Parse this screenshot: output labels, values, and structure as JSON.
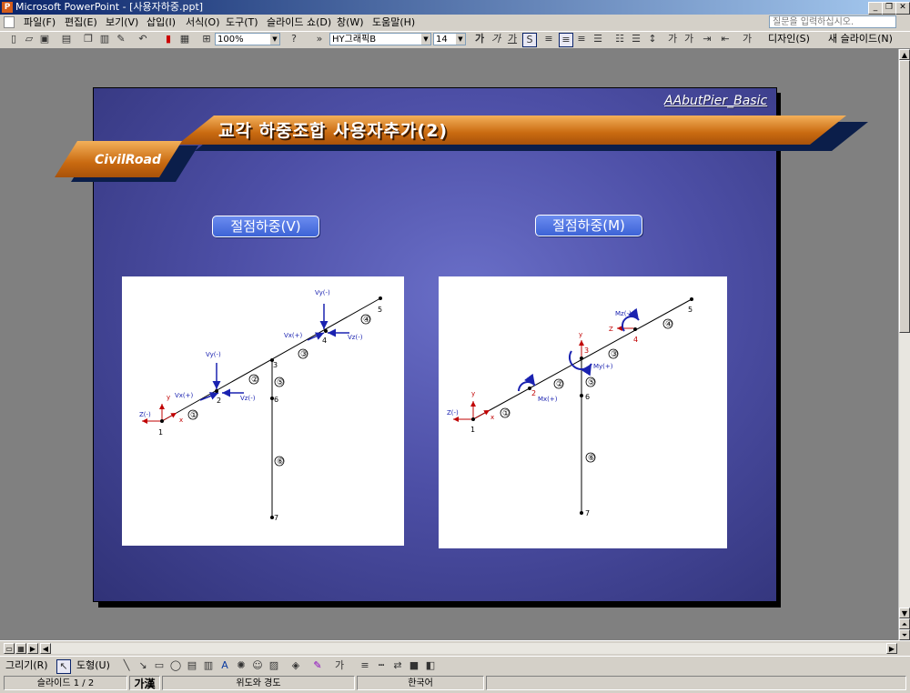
{
  "window": {
    "title": "Microsoft PowerPoint - [사용자하중.ppt]",
    "app_icon": "powerpoint-icon",
    "controls": [
      "_",
      "❐",
      "✕"
    ]
  },
  "menubar": {
    "doc_icon": "document-icon",
    "items": [
      "파일(F)",
      "편집(E)",
      "보기(V)",
      "삽입(I)",
      "서식(O)",
      "도구(T)",
      "슬라이드 쇼(D)",
      "창(W)",
      "도움말(H)"
    ],
    "help_placeholder": "질문을 입력하십시오."
  },
  "toolbar": {
    "zoom": "100%",
    "font": "HY그래픽B",
    "font_size": "14",
    "design_label": "디자인(S)",
    "new_slide_label": "새 슬라이드(N)",
    "icons": [
      "new-icon",
      "open-icon",
      "save-icon",
      "print-icon",
      "copy-icon",
      "paste-icon",
      "format-painter-icon",
      "undo-icon",
      "chart-icon",
      "table-icon",
      "grid-icon",
      "help-icon"
    ]
  },
  "slide": {
    "tag": "AAbutPier_Basic",
    "title": "교각 하중조합 사용자추가(2)",
    "logo": "CivilRoad",
    "left_label": "절점하중(V)",
    "right_label": "절점하중(M)",
    "left_diagram": {
      "nodes": [
        "1",
        "2",
        "3",
        "4",
        "5",
        "6",
        "7"
      ],
      "members": [
        "①",
        "②",
        "③",
        "④",
        "⑤",
        "⑥"
      ],
      "axis_labels": [
        "y",
        "x",
        "Z(-)"
      ],
      "loads": [
        "Vy(-)",
        "Vx(+)",
        "Vz(-)",
        "Vy(-)",
        "Vx(+)",
        "Vz(-)"
      ]
    },
    "right_diagram": {
      "nodes": [
        "1",
        "2",
        "3",
        "4",
        "5",
        "6",
        "7"
      ],
      "members": [
        "①",
        "②",
        "③",
        "④",
        "⑤",
        "⑥"
      ],
      "axis_labels": [
        "y",
        "x",
        "Z(-)",
        "y",
        "Z"
      ],
      "loads": [
        "Mx(+)",
        "My(+)",
        "Mz(-)"
      ]
    }
  },
  "drawbar": {
    "draw_label": "그리기(R)",
    "shapes_label": "도형(U)"
  },
  "statusbar": {
    "slide_info": "슬라이드 1 / 2",
    "ime": "가漢",
    "design": "위도와 경도",
    "language": "한국어"
  },
  "colors": {
    "titlebar": "#0a246a",
    "slide_bg": "#4d4fa6",
    "banner": "#e0892a",
    "load_arrow": "#1a22b0",
    "axis_red": "#c00000"
  }
}
